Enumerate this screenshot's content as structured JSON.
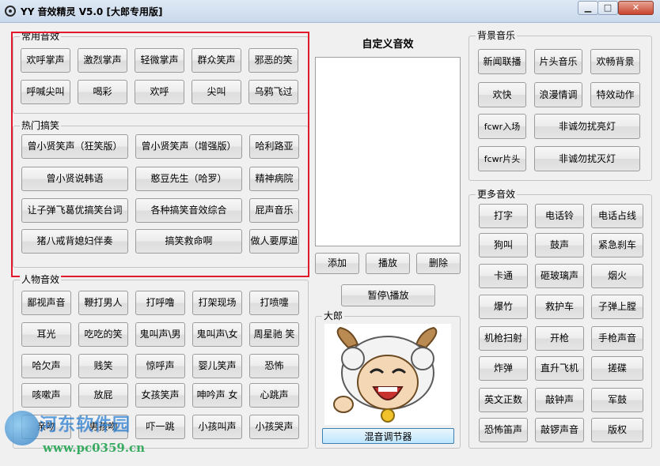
{
  "window": {
    "title": "YY 音效精灵 V5.0 [大郎专用版]",
    "minimize_icon": "minimize-icon",
    "maximize_icon": "maximize-icon",
    "close_icon": "close-icon"
  },
  "common": {
    "label": "常用音效",
    "buttons": [
      "欢呼掌声",
      "激烈掌声",
      "轻微掌声",
      "群众笑声",
      "邪恶的笑",
      "呼喊尖叫",
      "喝彩",
      "欢呼",
      "尖叫",
      "乌鸦飞过"
    ]
  },
  "hot": {
    "label": "热门搞笑",
    "buttons": [
      "曾小贤笑声（狂笑版）",
      "曾小贤笑声（增强版）",
      "哈利路亚",
      "曾小贤说韩语",
      "憨豆先生（哈罗）",
      "精神病院",
      "让子弹飞葛优搞笑台词",
      "各种搞笑音效综合",
      "屁声音乐",
      "猪八戒背媳妇伴奏",
      "搞笑救命啊",
      "做人要厚道"
    ]
  },
  "people": {
    "label": "人物音效",
    "buttons": [
      "鄙视声音",
      "鞭打男人",
      "打呼噜",
      "打架现场",
      "打喷嚏",
      "耳光",
      "吃吃的笑",
      "鬼叫声\\男",
      "鬼叫声\\女",
      "周星驰 笑",
      "哈欠声",
      "贱笑",
      "惊呼声",
      "婴儿笑声",
      "恐怖",
      "咳嗽声",
      "放屁",
      "女孩笑声",
      "呻吟声 女",
      "心跳声",
      "亲吻",
      "男孩吻",
      "吓一跳",
      "小孩叫声",
      "小孩哭声"
    ]
  },
  "custom": {
    "title": "自定义音效",
    "add": "添加",
    "play": "播放",
    "delete": "删除",
    "pause_play": "暂停\\播放"
  },
  "dalang": {
    "label": "大郎",
    "mixer": "混音调节器"
  },
  "bgm": {
    "label": "背景音乐",
    "buttons": [
      "新闻联播",
      "片头音乐",
      "欢畅背景",
      "欢快",
      "浪漫情调",
      "特效动作",
      "fcwr入场",
      "非诚勿扰亮灯",
      "fcwr片头",
      "非诚勿扰灭灯"
    ]
  },
  "more": {
    "label": "更多音效",
    "buttons": [
      "打字",
      "电话铃",
      "电话占线",
      "狗叫",
      "鼓声",
      "紧急刹车",
      "卡通",
      "砸玻璃声",
      "烟火",
      "爆竹",
      "救护车",
      "子弹上膛",
      "机枪扫射",
      "开枪",
      "手枪声音",
      "炸弹",
      "直升飞机",
      "搓碟",
      "英文正数",
      "敲钟声",
      "军鼓",
      "恐怖笛声",
      "敲锣声音",
      "版权"
    ]
  },
  "watermark": {
    "text": "河东软件园",
    "url": "www.pc0359.cn"
  },
  "colors": {
    "highlight": "#e1192b",
    "mixer_border": "#3c7fb1"
  }
}
